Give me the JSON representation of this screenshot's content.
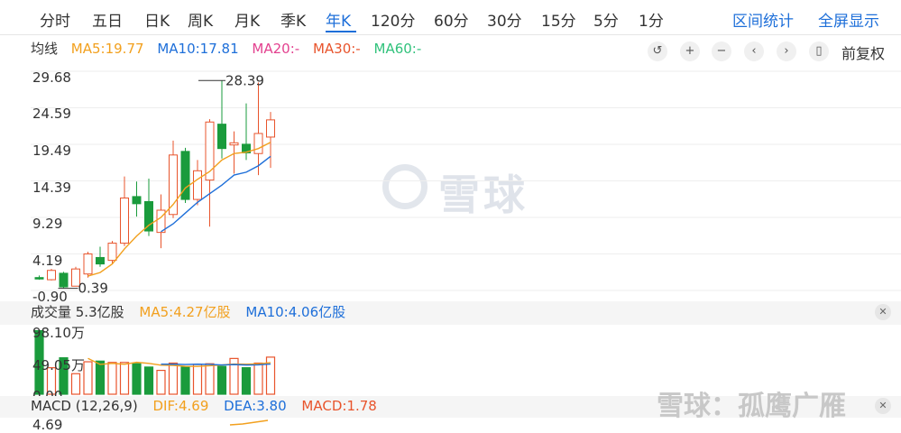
{
  "tabs": [
    "分时",
    "五日",
    "日K",
    "周K",
    "月K",
    "季K",
    "年K",
    "120分",
    "60分",
    "30分",
    "15分",
    "5分",
    "1分"
  ],
  "active_tab": "年K",
  "header_links": {
    "range_stats": "区间统计",
    "fullscreen": "全屏显示"
  },
  "ma_legend": {
    "label": "均线",
    "ma5": "MA5:19.77",
    "ma10": "MA10:17.81",
    "ma20": "MA20:-",
    "ma30": "MA30:-",
    "ma60": "MA60:-",
    "colors": {
      "label": "#333333",
      "ma5": "#f2a01e",
      "ma10": "#1e6fd9",
      "ma20": "#e3418f",
      "ma30": "#e8542c",
      "ma60": "#31c27c"
    }
  },
  "controls": {
    "icons": [
      "undo-icon",
      "zoom-in-icon",
      "zoom-out-icon",
      "pan-left-icon",
      "pan-right-icon",
      "candle-type-icon"
    ],
    "adjust_label": "前复权"
  },
  "volume_legend": {
    "label": "成交量 5.3亿股",
    "ma5": "MA5:4.27亿股",
    "ma10": "MA10:4.06亿股"
  },
  "macd_legend": {
    "label": "MACD (12,26,9)",
    "dif": "DIF:4.69",
    "dea": "DEA:3.80",
    "macd": "MACD:1.78"
  },
  "watermark_text": "雪球",
  "footer_watermark": "雪球：孤鹰广雁",
  "colors": {
    "up": "#e8542c",
    "down": "#1a9b3c",
    "accent": "#1e6fd9",
    "ma5": "#f2a01e",
    "ma10": "#1e6fd9"
  },
  "chart_data": {
    "type": "candlestick",
    "price_axis": {
      "ticks": [
        "29.68",
        "24.59",
        "19.49",
        "14.39",
        "9.29",
        "4.19",
        "-0.90"
      ],
      "range": [
        -0.9,
        29.68
      ]
    },
    "annotations": {
      "max_label": "28.39",
      "min_label": "0.39"
    },
    "candles": [
      {
        "o": 0.9,
        "c": 0.7,
        "h": 1.2,
        "l": 0.6
      },
      {
        "o": 0.6,
        "c": 1.9,
        "h": 2.1,
        "l": 0.5
      },
      {
        "o": 1.5,
        "c": -0.4,
        "h": 1.7,
        "l": -0.6
      },
      {
        "o": -0.3,
        "c": 2.1,
        "h": 2.4,
        "l": 0.39
      },
      {
        "o": 1.4,
        "c": 4.2,
        "h": 4.5,
        "l": 0.9
      },
      {
        "o": 3.7,
        "c": 2.8,
        "h": 5.2,
        "l": 2.4
      },
      {
        "o": 3.3,
        "c": 5.7,
        "h": 6.0,
        "l": 2.8
      },
      {
        "o": 5.7,
        "c": 12.0,
        "h": 15.0,
        "l": 5.3
      },
      {
        "o": 12.2,
        "c": 11.2,
        "h": 14.3,
        "l": 9.4
      },
      {
        "o": 11.5,
        "c": 7.4,
        "h": 14.7,
        "l": 6.7
      },
      {
        "o": 7.2,
        "c": 10.3,
        "h": 12.5,
        "l": 5.0
      },
      {
        "o": 9.7,
        "c": 18.0,
        "h": 20.0,
        "l": 9.2
      },
      {
        "o": 18.5,
        "c": 11.8,
        "h": 19.0,
        "l": 11.3
      },
      {
        "o": 11.8,
        "c": 15.8,
        "h": 17.3,
        "l": 11.0
      },
      {
        "o": 14.5,
        "c": 22.6,
        "h": 23.0,
        "l": 8.0
      },
      {
        "o": 22.3,
        "c": 18.9,
        "h": 28.39,
        "l": 17.5
      },
      {
        "o": 19.4,
        "c": 19.7,
        "h": 21.3,
        "l": 15.4
      },
      {
        "o": 19.5,
        "c": 18.3,
        "h": 25.2,
        "l": 17.3
      },
      {
        "o": 18.2,
        "c": 21.0,
        "h": 28.1,
        "l": 15.2
      },
      {
        "o": 20.5,
        "c": 22.9,
        "h": 24.0,
        "l": 16.2
      }
    ],
    "ma5": [
      null,
      null,
      null,
      null,
      1.1,
      1.6,
      2.8,
      4.9,
      6.7,
      8.2,
      9.3,
      11.1,
      13.4,
      14.6,
      15.7,
      17.3,
      18.2,
      18.4,
      18.9,
      19.77
    ],
    "ma10": [
      null,
      null,
      null,
      null,
      null,
      null,
      null,
      null,
      null,
      null,
      7.3,
      8.4,
      9.9,
      11.4,
      12.6,
      13.8,
      15.2,
      15.6,
      16.5,
      17.81
    ],
    "volume": {
      "ticks": [
        "98.10万",
        "49.05万",
        "0.00"
      ],
      "range": [
        0,
        98.1
      ],
      "unit": "万",
      "bars": [
        96,
        40,
        55,
        31,
        49,
        50,
        48,
        48,
        46,
        41,
        36,
        47,
        41,
        45,
        46,
        42,
        54,
        40,
        47,
        56
      ],
      "ma5": [
        null,
        null,
        null,
        null,
        54.2,
        45.0,
        46.6,
        45.2,
        48.2,
        46.6,
        43.8,
        43.6,
        42.2,
        42.0,
        43.0,
        44.2,
        45.6,
        45.4,
        45.8,
        47.8
      ],
      "ma10": [
        null,
        null,
        null,
        null,
        null,
        null,
        null,
        null,
        null,
        null,
        45.4,
        45.3,
        44.9,
        45.3,
        45.0,
        44.2,
        44.8,
        44.1,
        44.4,
        45.6
      ]
    },
    "macd": {
      "ticks": [
        "4.69"
      ],
      "dif_series": [
        4.1,
        4.3,
        4.5,
        4.69
      ]
    }
  }
}
